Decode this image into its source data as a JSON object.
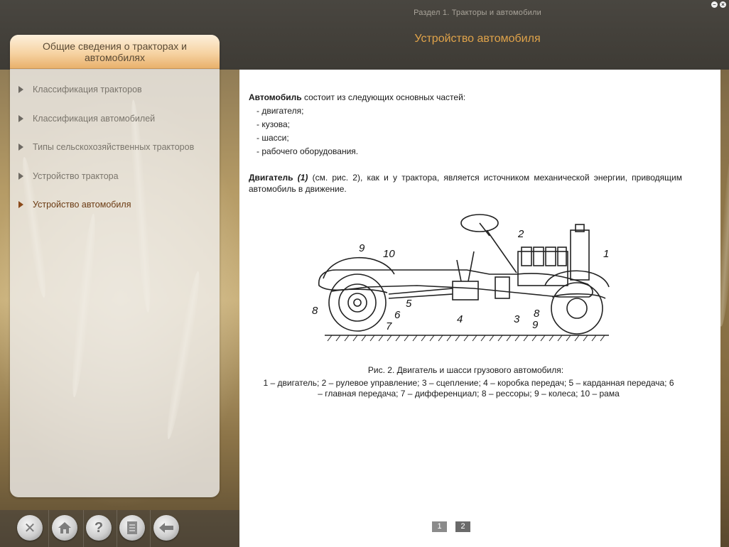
{
  "window": {
    "section_label": "Раздел 1. Тракторы и автомобили",
    "page_heading": "Устройство автомобиля",
    "buttons": {
      "minimize_icon": "minus-icon",
      "close_icon": "close-icon"
    }
  },
  "sidebar": {
    "header": "Общие сведения о тракторах и автомобилях",
    "items": [
      {
        "label": "Классификация тракторов",
        "active": false
      },
      {
        "label": "Классификация автомобилей",
        "active": false
      },
      {
        "label": "Типы сельскохозяйственных тракторов",
        "active": false
      },
      {
        "label": "Устройство трактора",
        "active": false
      },
      {
        "label": "Устройство автомобиля",
        "active": true
      }
    ]
  },
  "toolbar": {
    "buttons": [
      {
        "name": "close-tool",
        "icon": "close-icon"
      },
      {
        "name": "home-tool",
        "icon": "home-icon"
      },
      {
        "name": "help-tool",
        "icon": "help-icon"
      },
      {
        "name": "contents-tool",
        "icon": "document-icon"
      },
      {
        "name": "back-tool",
        "icon": "arrow-left-icon"
      }
    ]
  },
  "content": {
    "intro_bold": "Автомобиль",
    "intro_text": " состоит из следующих основных частей:",
    "parts": [
      "- двигателя;",
      "- кузова;",
      "- шасси;",
      "- рабочего оборудования."
    ],
    "engine_bold": "Двигатель",
    "engine_ref": " (1)",
    "engine_text": " (см. рис. 2), как и у трактора, является источником механической энергии, приводящим автомобиль в движение.",
    "figure_labels": [
      "1",
      "2",
      "3",
      "4",
      "5",
      "6",
      "7",
      "8",
      "9",
      "10",
      "8",
      "9"
    ],
    "caption_title": "Рис. 2. Двигатель и шасси грузового автомобиля:",
    "caption_text": "1 – двигатель; 2 – рулевое управление; 3 – сцепление; 4 – коробка передач; 5 – карданная передача; 6 – главная передача; 7 – дифференциал; 8 – рессоры; 9 – колеса; 10 – рама"
  },
  "pager": {
    "pages": [
      "1",
      "2"
    ],
    "current": "2"
  },
  "colors": {
    "heading": "#e0a34a",
    "active_item": "#6b3b13",
    "topbar": "#46433d"
  }
}
